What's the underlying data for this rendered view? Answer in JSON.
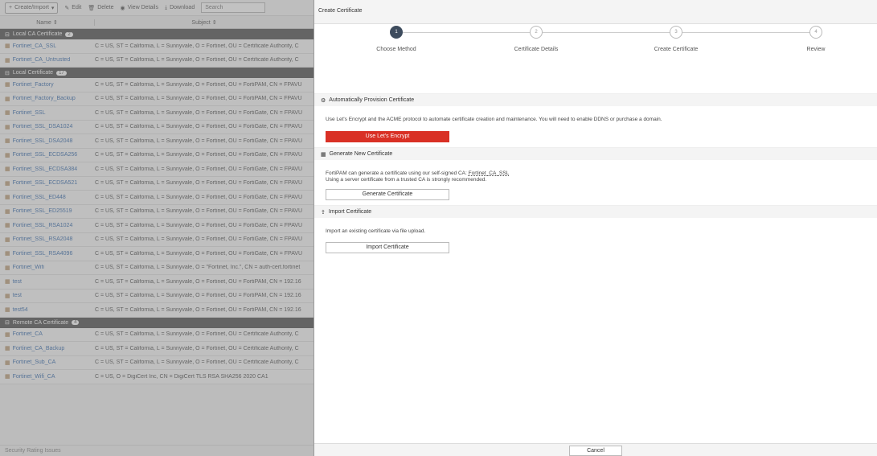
{
  "left": {
    "toolbar": {
      "create": "Create/Import",
      "edit": "Edit",
      "delete": "Delete",
      "view": "View Details",
      "download": "Download",
      "search_placeholder": "Search"
    },
    "columns": {
      "name": "Name",
      "subject": "Subject"
    },
    "groups": [
      {
        "title": "Local CA Certificate",
        "count": "2",
        "rows": [
          {
            "name": "Fortinet_CA_SSL",
            "subject": "C = US, ST = California, L = Sunnyvale, O = Fortinet, OU = Certificate Authority, C"
          },
          {
            "name": "Fortinet_CA_Untrusted",
            "subject": "C = US, ST = California, L = Sunnyvale, O = Fortinet, OU = Certificate Authority, C"
          }
        ]
      },
      {
        "title": "Local Certificate",
        "count": "17",
        "rows": [
          {
            "name": "Fortinet_Factory",
            "subject": "C = US, ST = California, L = Sunnyvale, O = Fortinet, OU = FortiPAM, CN = FPAVU"
          },
          {
            "name": "Fortinet_Factory_Backup",
            "subject": "C = US, ST = California, L = Sunnyvale, O = Fortinet, OU = FortiPAM, CN = FPAVU"
          },
          {
            "name": "Fortinet_SSL",
            "subject": "C = US, ST = California, L = Sunnyvale, O = Fortinet, OU = FortiGate, CN = FPAVU"
          },
          {
            "name": "Fortinet_SSL_DSA1024",
            "subject": "C = US, ST = California, L = Sunnyvale, O = Fortinet, OU = FortiGate, CN = FPAVU"
          },
          {
            "name": "Fortinet_SSL_DSA2048",
            "subject": "C = US, ST = California, L = Sunnyvale, O = Fortinet, OU = FortiGate, CN = FPAVU"
          },
          {
            "name": "Fortinet_SSL_ECDSA256",
            "subject": "C = US, ST = California, L = Sunnyvale, O = Fortinet, OU = FortiGate, CN = FPAVU"
          },
          {
            "name": "Fortinet_SSL_ECDSA384",
            "subject": "C = US, ST = California, L = Sunnyvale, O = Fortinet, OU = FortiGate, CN = FPAVU"
          },
          {
            "name": "Fortinet_SSL_ECDSA521",
            "subject": "C = US, ST = California, L = Sunnyvale, O = Fortinet, OU = FortiGate, CN = FPAVU"
          },
          {
            "name": "Fortinet_SSL_ED448",
            "subject": "C = US, ST = California, L = Sunnyvale, O = Fortinet, OU = FortiGate, CN = FPAVU"
          },
          {
            "name": "Fortinet_SSL_ED25519",
            "subject": "C = US, ST = California, L = Sunnyvale, O = Fortinet, OU = FortiGate, CN = FPAVU"
          },
          {
            "name": "Fortinet_SSL_RSA1024",
            "subject": "C = US, ST = California, L = Sunnyvale, O = Fortinet, OU = FortiGate, CN = FPAVU"
          },
          {
            "name": "Fortinet_SSL_RSA2048",
            "subject": "C = US, ST = California, L = Sunnyvale, O = Fortinet, OU = FortiGate, CN = FPAVU"
          },
          {
            "name": "Fortinet_SSL_RSA4096",
            "subject": "C = US, ST = California, L = Sunnyvale, O = Fortinet, OU = FortiGate, CN = FPAVU"
          },
          {
            "name": "Fortinet_Wifi",
            "subject": "C = US, ST = California, L = Sunnyvale, O = \"Fortinet, Inc.\", CN = auth-cert.fortinet"
          },
          {
            "name": "test",
            "subject": "C = US, ST = California, L = Sunnyvale, O = Fortinet, OU = FortiPAM, CN = 192.16"
          },
          {
            "name": "test",
            "subject": "C = US, ST = California, L = Sunnyvale, O = Fortinet, OU = FortiPAM, CN = 192.16"
          },
          {
            "name": "test54",
            "subject": "C = US, ST = California, L = Sunnyvale, O = Fortinet, OU = FortiPAM, CN = 192.16"
          }
        ]
      },
      {
        "title": "Remote CA Certificate",
        "count": "4",
        "rows": [
          {
            "name": "Fortinet_CA",
            "subject": "C = US, ST = California, L = Sunnyvale, O = Fortinet, OU = Certificate Authority, C"
          },
          {
            "name": "Fortinet_CA_Backup",
            "subject": "C = US, ST = California, L = Sunnyvale, O = Fortinet, OU = Certificate Authority, C"
          },
          {
            "name": "Fortinet_Sub_CA",
            "subject": "C = US, ST = California, L = Sunnyvale, O = Fortinet, OU = Certificate Authority, C"
          },
          {
            "name": "Fortinet_Wifi_CA",
            "subject": "C = US, O = DigiCert Inc, CN = DigiCert TLS RSA SHA256 2020 CA1"
          }
        ]
      }
    ],
    "footer": "Security Rating Issues"
  },
  "dialog": {
    "title": "Create Certificate",
    "steps": [
      {
        "num": "1",
        "label": "Choose Method"
      },
      {
        "num": "2",
        "label": "Certificate Details"
      },
      {
        "num": "3",
        "label": "Create Certificate"
      },
      {
        "num": "4",
        "label": "Review"
      }
    ],
    "auto": {
      "heading": "Automatically Provision Certificate",
      "text": "Use Let's Encrypt and the ACME protocol to automate certificate creation and maintenance. You will need to enable DDNS or purchase a domain.",
      "button": "Use Let's Encrypt"
    },
    "generate": {
      "heading": "Generate New Certificate",
      "text1_prefix": "FortiPAM can generate a certificate using our self-signed CA: ",
      "text1_ca": "Fortinet_CA_SSL",
      "text2": "Using a server certificate from a trusted CA is strongly recommended.",
      "button": "Generate Certificate"
    },
    "import": {
      "heading": "Import Certificate",
      "text": "Import an existing certificate via file upload.",
      "button": "Import Certificate"
    },
    "cancel": "Cancel"
  },
  "colors": {
    "accent_red": "#d93025",
    "active_step": "#3e4c5e"
  }
}
